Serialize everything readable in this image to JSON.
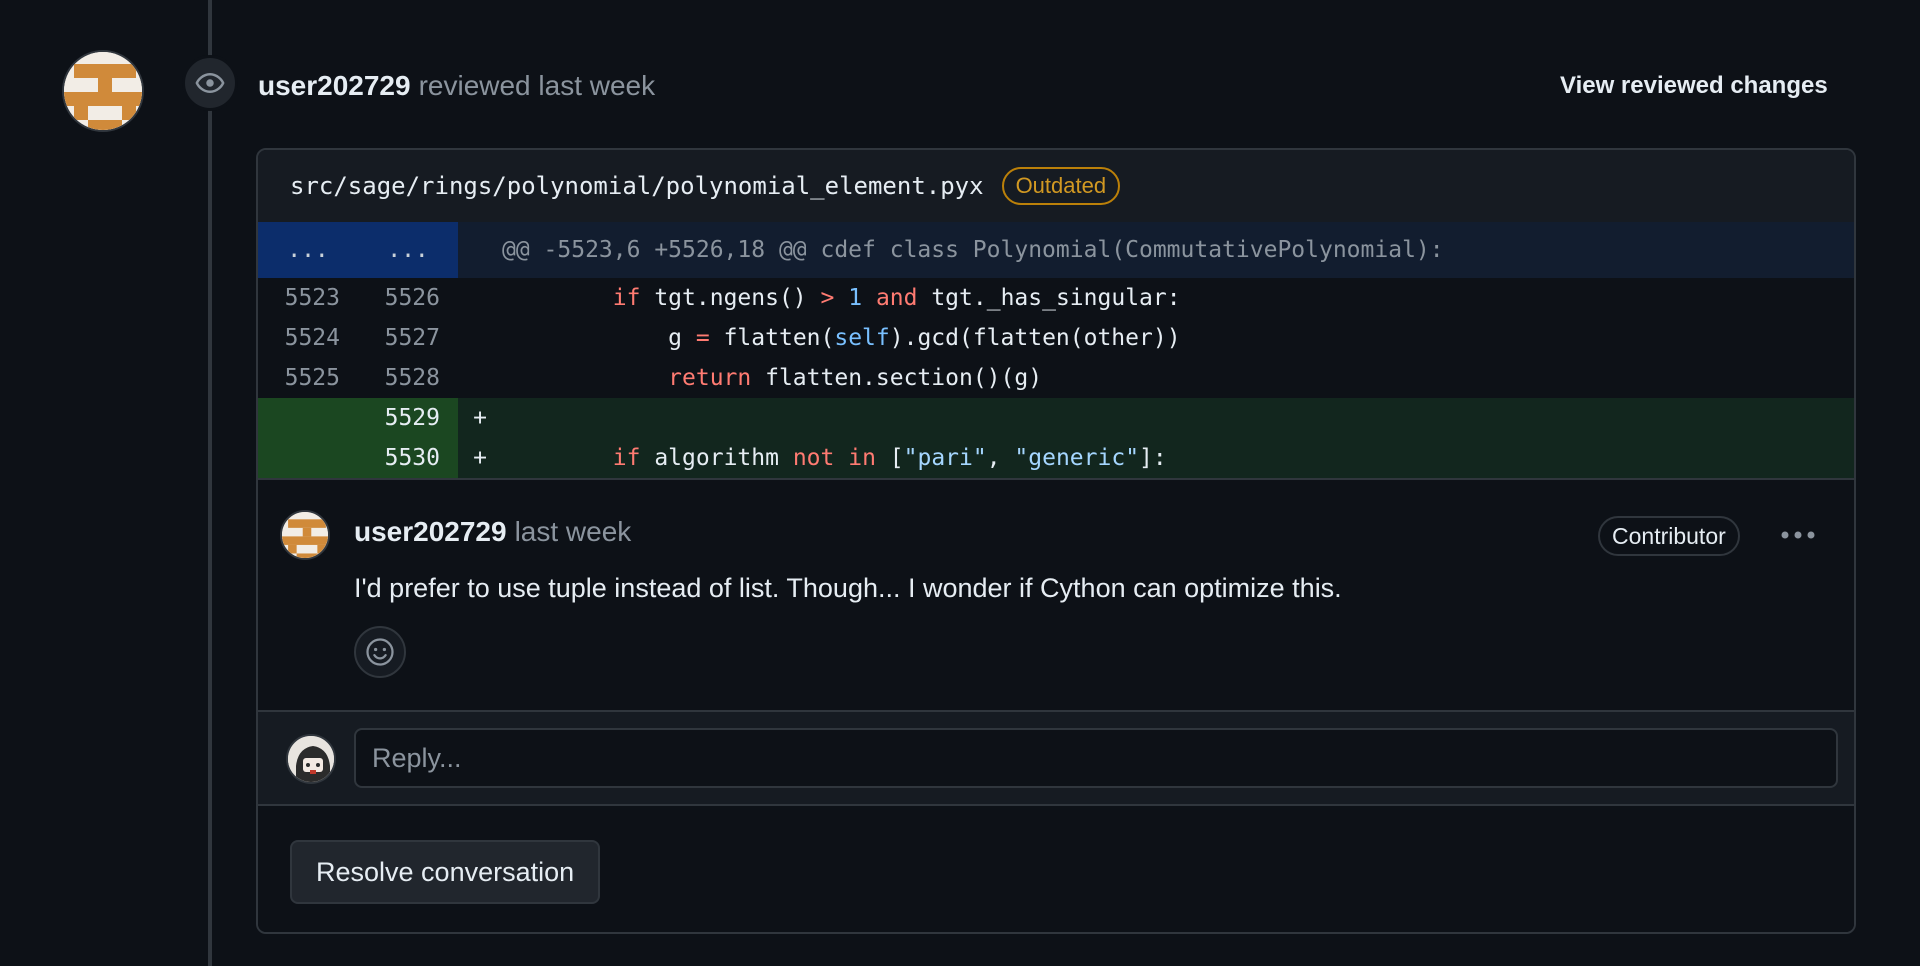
{
  "review": {
    "author": "user202729",
    "action": "reviewed last week",
    "view_changes_label": "View reviewed changes"
  },
  "file": {
    "path": "src/sage/rings/polynomial/polynomial_element.pyx",
    "badge": "Outdated"
  },
  "diff": {
    "hunk": {
      "left_num": "...",
      "right_num": "...",
      "text": "@@ -5523,6 +5526,18 @@ cdef class Polynomial(CommutativePolynomial):"
    },
    "lines": [
      {
        "left": "5523",
        "right": "5526",
        "marker": "",
        "type": "context"
      },
      {
        "left": "5524",
        "right": "5527",
        "marker": "",
        "type": "context"
      },
      {
        "left": "5525",
        "right": "5528",
        "marker": "",
        "type": "context"
      },
      {
        "left": "",
        "right": "5529",
        "marker": "+",
        "type": "add"
      },
      {
        "left": "",
        "right": "5530",
        "marker": "+",
        "type": "add"
      }
    ],
    "code": {
      "l1": {
        "indent": "        ",
        "kw1": "if",
        "t1": " tgt.ngens() ",
        "op": ">",
        "sp": " ",
        "num": "1",
        "sp2": " ",
        "kw2": "and",
        "t2": " tgt._has_singular:"
      },
      "l2": {
        "indent": "            ",
        "t1": "g ",
        "op": "=",
        "t2": " flatten(",
        "self": "self",
        "t3": ").gcd(flatten(other))"
      },
      "l3": {
        "indent": "            ",
        "kw": "return",
        "t1": " flatten.section()(g)"
      },
      "l4": {
        "text": ""
      },
      "l5": {
        "indent": "        ",
        "kw1": "if",
        "t1": " algorithm ",
        "kw2": "not",
        "sp": " ",
        "kw3": "in",
        "t2": " [",
        "s1": "\"pari\"",
        "t3": ", ",
        "s2": "\"generic\"",
        "t4": "]:"
      }
    }
  },
  "comment": {
    "author": "user202729",
    "time": "last week",
    "badge": "Contributor",
    "body": "I'd prefer to use tuple instead of list. Though... I wonder if Cython can optimize this."
  },
  "reply": {
    "placeholder": "Reply..."
  },
  "resolve_label": "Resolve conversation",
  "colors": {
    "background": "#0d1117",
    "border": "#30363d",
    "outdated": "#d29922",
    "addition_bg": "#12261e",
    "hunk_bg": "#121d2f",
    "keyword": "#ff7b72",
    "constant": "#79c0ff",
    "string": "#a5d6ff"
  },
  "icons": {
    "event": "eye-icon",
    "kebab": "kebab-horizontal-icon",
    "emoji": "smiley-icon"
  }
}
